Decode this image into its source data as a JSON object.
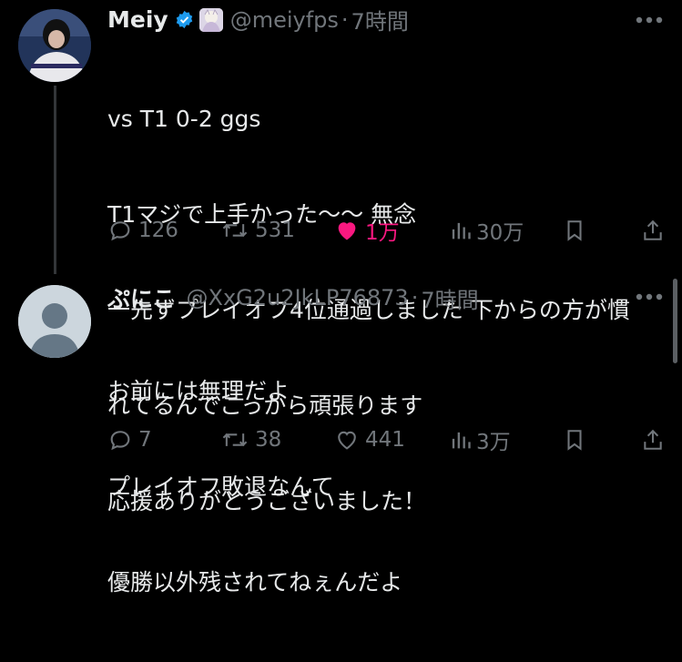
{
  "tweet1": {
    "name": "Meiy",
    "handle": "@meiyfps",
    "time": "7時間",
    "lines": [
      "vs T1 0-2 ggs",
      "T1マジで上手かった〜〜 無念",
      "一先ずプレイオフ4位通過しました 下からの方が慣",
      "れてるんでこっから頑張ります",
      "応援ありがとうございました！"
    ],
    "replies": "126",
    "reposts": "531",
    "likes": "1万",
    "views": "30万",
    "like_color": "#f91880"
  },
  "tweet2": {
    "name": "ぷにこ",
    "handle": "@XxG2u2JkLP76873",
    "time": "7時間",
    "lines": [
      "お前には無理だよ",
      "プレイオフ敗退なんて",
      "優勝以外残されてねぇんだよ"
    ],
    "replies": "7",
    "reposts": "38",
    "likes": "441",
    "views": "3万"
  },
  "colors": {
    "verified": "#1d9bf0",
    "muted": "#71767b",
    "text": "#e7e9ea"
  }
}
